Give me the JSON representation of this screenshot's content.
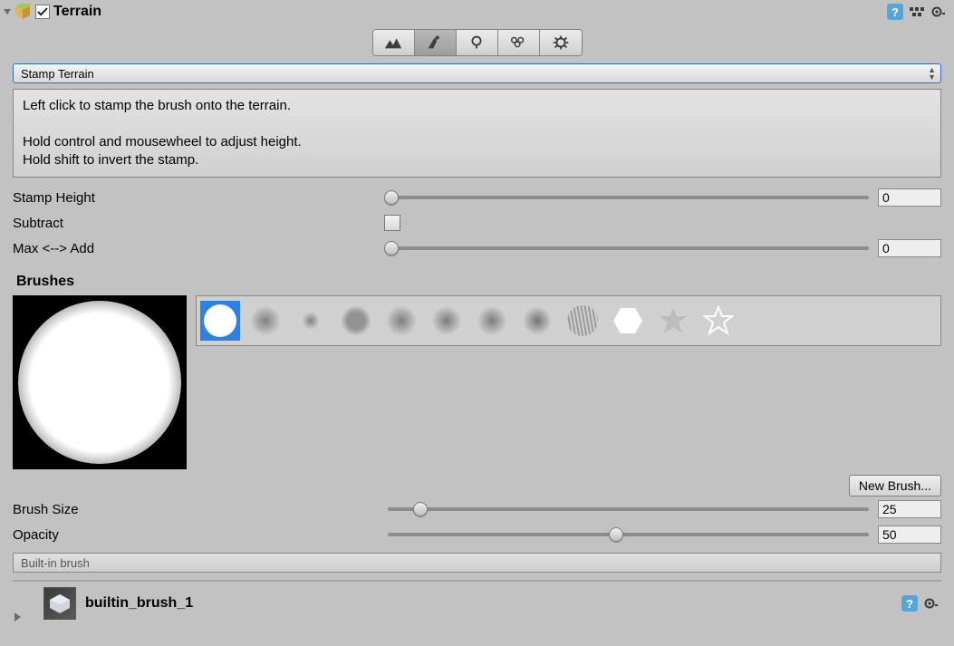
{
  "header": {
    "checked": true,
    "title": "Terrain"
  },
  "toolbar": {
    "active_index": 1,
    "icons": [
      "terrain-raise-icon",
      "terrain-paint-icon",
      "terrain-tree-icon",
      "terrain-detail-icon",
      "terrain-settings-icon"
    ]
  },
  "mode_dropdown": "Stamp Terrain",
  "info_lines": [
    "Left click to stamp the brush onto the terrain.",
    "",
    "Hold control and mousewheel to adjust height.",
    "Hold shift to invert the stamp."
  ],
  "props": {
    "stamp_height": {
      "label": "Stamp Height",
      "value": "0",
      "slider_pct": 0
    },
    "subtract": {
      "label": "Subtract",
      "checked": false
    },
    "max_add": {
      "label": "Max <--> Add",
      "value": "0",
      "slider_pct": 0
    }
  },
  "brushes": {
    "title": "Brushes",
    "new_button": "New Brush...",
    "thumbs": [
      "soft-circle",
      "ring",
      "tiny-dot",
      "noise-a",
      "noise-b",
      "noise-c",
      "noise-d",
      "noise-e",
      "streaks",
      "hexagon",
      "star-filled",
      "star-outline"
    ]
  },
  "brush_size": {
    "label": "Brush Size",
    "value": "25",
    "slider_pct": 6
  },
  "opacity": {
    "label": "Opacity",
    "value": "50",
    "slider_pct": 46
  },
  "note": "Built-in brush",
  "asset": {
    "name": "builtin_brush_1"
  }
}
